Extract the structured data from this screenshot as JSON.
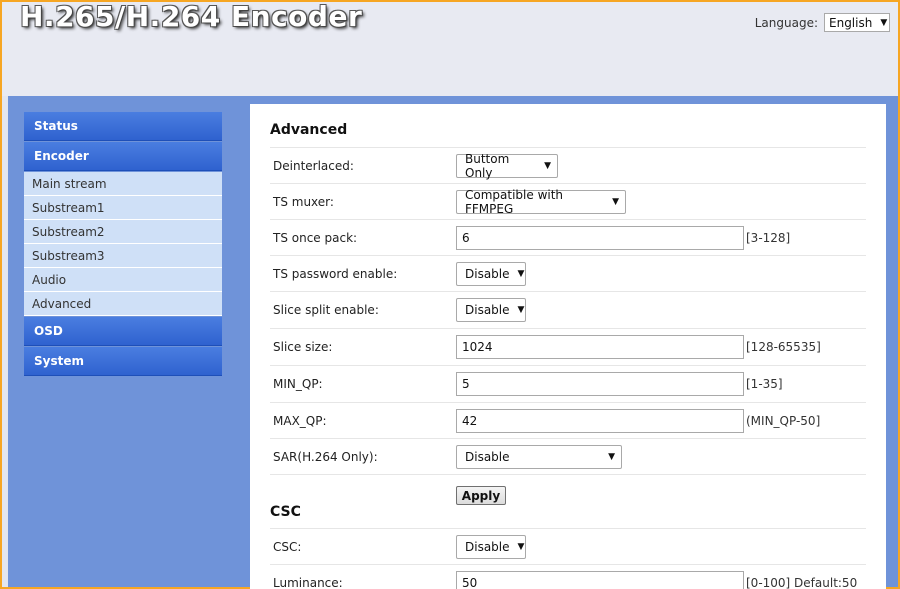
{
  "header": {
    "brand": "H.265/H.264 Encoder",
    "language_label": "Language:",
    "language_value": "English"
  },
  "sidebar": {
    "status": "Status",
    "encoder": "Encoder",
    "items": [
      "Main stream",
      "Substream1",
      "Substream2",
      "Substream3",
      "Audio",
      "Advanced"
    ],
    "osd": "OSD",
    "system": "System"
  },
  "advanced": {
    "title": "Advanced",
    "deinterlaced": {
      "label": "Deinterlaced:",
      "value": "Buttom Only"
    },
    "ts_muxer": {
      "label": "TS muxer:",
      "value": "Compatible with FFMPEG"
    },
    "ts_once_pack": {
      "label": "TS once pack:",
      "value": "6",
      "hint": "[3-128]"
    },
    "ts_password": {
      "label": "TS password enable:",
      "value": "Disable"
    },
    "slice_split": {
      "label": "Slice split enable:",
      "value": "Disable"
    },
    "slice_size": {
      "label": "Slice size:",
      "value": "1024",
      "hint": "[128-65535]"
    },
    "min_qp": {
      "label": "MIN_QP:",
      "value": "5",
      "hint": "[1-35]"
    },
    "max_qp": {
      "label": "MAX_QP:",
      "value": "42",
      "hint": "(MIN_QP-50]"
    },
    "sar": {
      "label": "SAR(H.264 Only):",
      "value": "Disable"
    },
    "apply": "Apply"
  },
  "csc": {
    "title": "CSC",
    "csc": {
      "label": "CSC:",
      "value": "Disable"
    },
    "luminance": {
      "label": "Luminance:",
      "value": "50",
      "hint": "[0-100] Default:50"
    }
  }
}
